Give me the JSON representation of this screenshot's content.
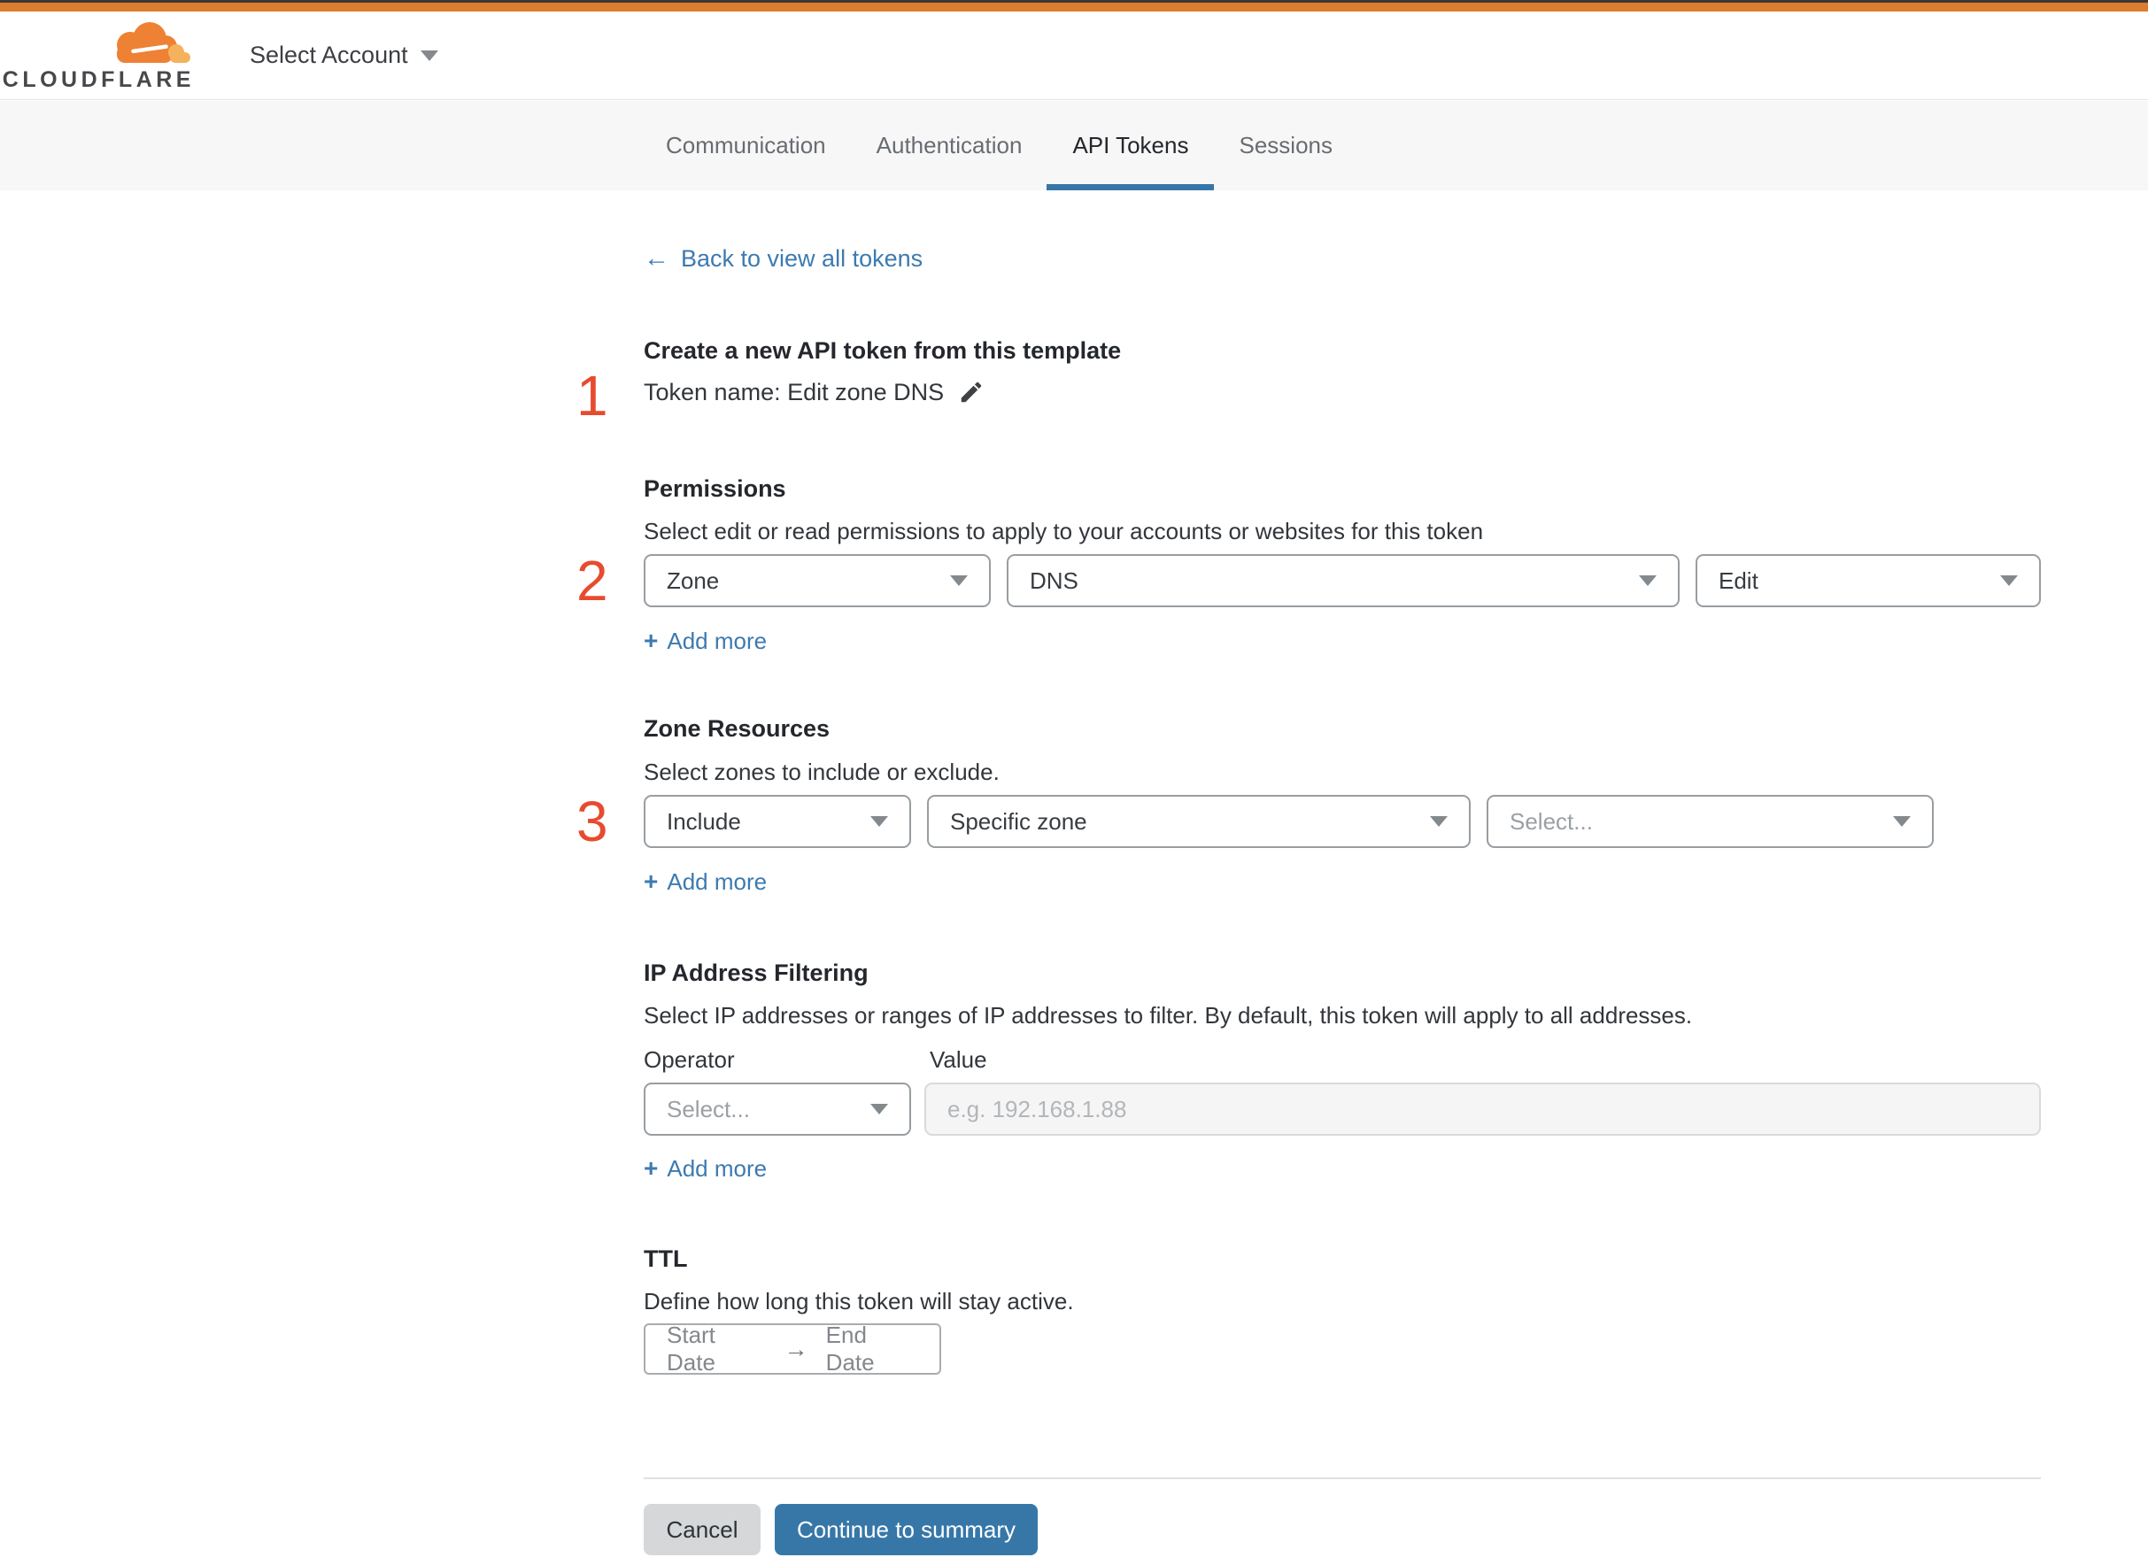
{
  "header": {
    "logo_text": "CLOUDFLARE",
    "account_label": "Select Account"
  },
  "tabs": [
    {
      "label": "Communication",
      "active": false
    },
    {
      "label": "Authentication",
      "active": false
    },
    {
      "label": "API Tokens",
      "active": true
    },
    {
      "label": "Sessions",
      "active": false
    }
  ],
  "back_link": {
    "arrow": "←",
    "label": "Back to view all tokens"
  },
  "token_section": {
    "step": "1",
    "heading": "Create a new API token from this template",
    "token_name": "Token name: Edit zone DNS"
  },
  "permissions": {
    "step": "2",
    "heading": "Permissions",
    "description": "Select edit or read permissions to apply to your accounts or websites for this token",
    "scope_value": "Zone",
    "resource_value": "DNS",
    "access_value": "Edit",
    "plus": "+",
    "add_more": "Add more"
  },
  "zone_resources": {
    "step": "3",
    "heading": "Zone Resources",
    "description": "Select zones to include or exclude.",
    "mode_value": "Include",
    "zone_type_value": "Specific zone",
    "zone_select_placeholder": "Select...",
    "plus": "+",
    "add_more": "Add more"
  },
  "ip_filtering": {
    "heading": "IP Address Filtering",
    "description": "Select IP addresses or ranges of IP addresses to filter. By default, this token will apply to all addresses.",
    "operator_label": "Operator",
    "value_label": "Value",
    "operator_placeholder": "Select...",
    "value_placeholder": "e.g. 192.168.1.88",
    "plus": "+",
    "add_more": "Add more"
  },
  "ttl": {
    "heading": "TTL",
    "description": "Define how long this token will stay active.",
    "start_label": "Start Date",
    "arrow": "→",
    "end_label": "End Date"
  },
  "footer": {
    "cancel_label": "Cancel",
    "continue_label": "Continue to summary"
  },
  "colors": {
    "accent_orange": "#dd7c2e",
    "link_blue": "#3d7ab0",
    "active_tab_blue": "#3576a8",
    "primary_button_blue": "#3777a8",
    "step_red": "#e74b2f",
    "logo_orange": "#ee8133",
    "logo_light_orange": "#f4b25c"
  }
}
